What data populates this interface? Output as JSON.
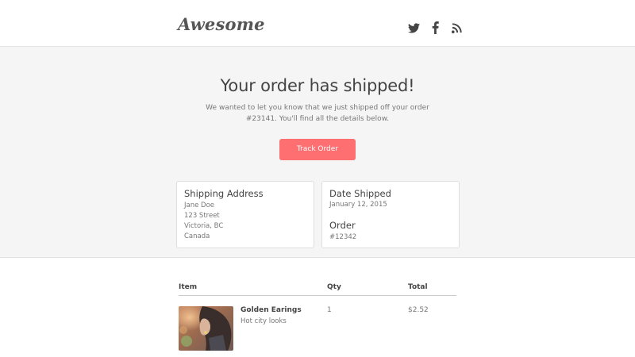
{
  "header": {
    "logo": "Awesome",
    "social": [
      {
        "name": "twitter-icon"
      },
      {
        "name": "facebook-icon"
      },
      {
        "name": "rss-icon"
      }
    ]
  },
  "hero": {
    "title": "Your order has shipped!",
    "message": "We wanted to let you know that we just shipped off your order #23141. You'll find all the details below.",
    "button_label": "Track Order",
    "button_color": "#fe6f72"
  },
  "shipping": {
    "heading": "Shipping Address",
    "lines": [
      "Jane Doe",
      "123 Street",
      "Victoria, BC",
      "Canada"
    ]
  },
  "shipment": {
    "date_heading": "Date Shipped",
    "date": "January 12, 2015",
    "order_heading": "Order",
    "order_number": "#12342"
  },
  "table": {
    "headers": {
      "item": "Item",
      "qty": "Qty",
      "total": "Total"
    },
    "rows": [
      {
        "name": "Golden Earings",
        "description": "Hot city looks",
        "qty": "1",
        "total": "$2.52"
      }
    ]
  },
  "colors": {
    "accent": "#fe6f72",
    "hero_bg": "#f5f5f5",
    "text": "#444444",
    "muted": "#777777"
  }
}
